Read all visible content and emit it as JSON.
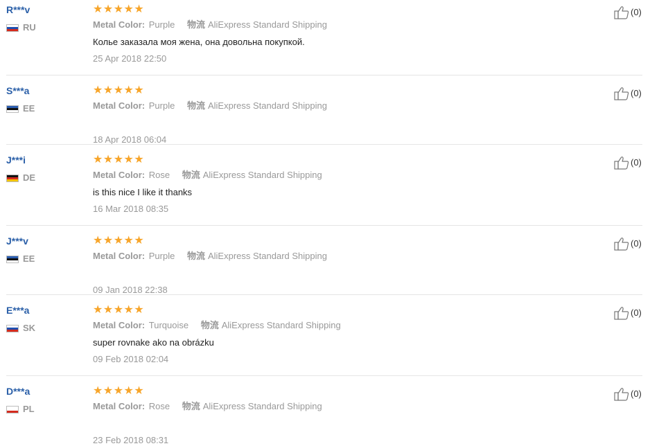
{
  "reviews": [
    {
      "user": "R***v",
      "country": "RU",
      "flag_colors": [
        "#ffffff",
        "#1f4fb0",
        "#d52b1e"
      ],
      "stars": [
        "★",
        "★",
        "★",
        "★",
        "★"
      ],
      "metal_label": "Metal Color:",
      "metal_value": "Purple",
      "shipping_label": "物流",
      "shipping_value": "AliExpress Standard Shipping",
      "comment": "Колье заказала моя жена, она довольна покупкой.",
      "date": "25 Apr 2018 22:50",
      "helpful_count": "(0)"
    },
    {
      "user": "S***a",
      "country": "EE",
      "flag_colors": [
        "#2a5db0",
        "#111111",
        "#ffffff"
      ],
      "stars": [
        "★",
        "★",
        "★",
        "★",
        "★"
      ],
      "metal_label": "Metal Color:",
      "metal_value": "Purple",
      "shipping_label": "物流",
      "shipping_value": "AliExpress Standard Shipping",
      "comment": "",
      "date": "18 Apr 2018 06:04",
      "helpful_count": "(0)"
    },
    {
      "user": "J***i",
      "country": "DE",
      "flag_colors": [
        "#111111",
        "#d52b1e",
        "#f5c400"
      ],
      "stars": [
        "★",
        "★",
        "★",
        "★",
        "★"
      ],
      "metal_label": "Metal Color:",
      "metal_value": "Rose",
      "shipping_label": "物流",
      "shipping_value": "AliExpress Standard Shipping",
      "comment": "is this nice I like it thanks",
      "date": "16 Mar 2018 08:35",
      "helpful_count": "(0)"
    },
    {
      "user": "J***v",
      "country": "EE",
      "flag_colors": [
        "#2a5db0",
        "#111111",
        "#ffffff"
      ],
      "stars": [
        "★",
        "★",
        "★",
        "★",
        "★"
      ],
      "metal_label": "Metal Color:",
      "metal_value": "Purple",
      "shipping_label": "物流",
      "shipping_value": "AliExpress Standard Shipping",
      "comment": "",
      "date": "09 Jan 2018 22:38",
      "helpful_count": "(0)"
    },
    {
      "user": "E***a",
      "country": "SK",
      "flag_colors": [
        "#ffffff",
        "#1f4fb0",
        "#d52b1e"
      ],
      "stars": [
        "★",
        "★",
        "★",
        "★",
        "★"
      ],
      "metal_label": "Metal Color:",
      "metal_value": "Turquoise",
      "shipping_label": "物流",
      "shipping_value": "AliExpress Standard Shipping",
      "comment": "super rovnake ako na obrázku",
      "date": "09 Feb 2018 02:04",
      "helpful_count": "(0)"
    },
    {
      "user": "D***a",
      "country": "PL",
      "flag_colors": [
        "#ffffff",
        "#ffffff",
        "#d52b1e"
      ],
      "stars": [
        "★",
        "★",
        "★",
        "★",
        "★"
      ],
      "metal_label": "Metal Color:",
      "metal_value": "Rose",
      "shipping_label": "物流",
      "shipping_value": "AliExpress Standard Shipping",
      "comment": "",
      "date": "23 Feb 2018 08:31",
      "helpful_count": "(0)"
    }
  ],
  "icons": {
    "star": "star-icon",
    "helpful": "thumbs-up-icon",
    "flag": "country-flag-icon"
  },
  "colors": {
    "username": "#2a5fa8",
    "star": "#f7a52a",
    "muted": "#999999",
    "text": "#222222",
    "divider": "#e5e5e5"
  },
  "rating": {
    "stars_filled": 5,
    "stars_total": 5
  }
}
